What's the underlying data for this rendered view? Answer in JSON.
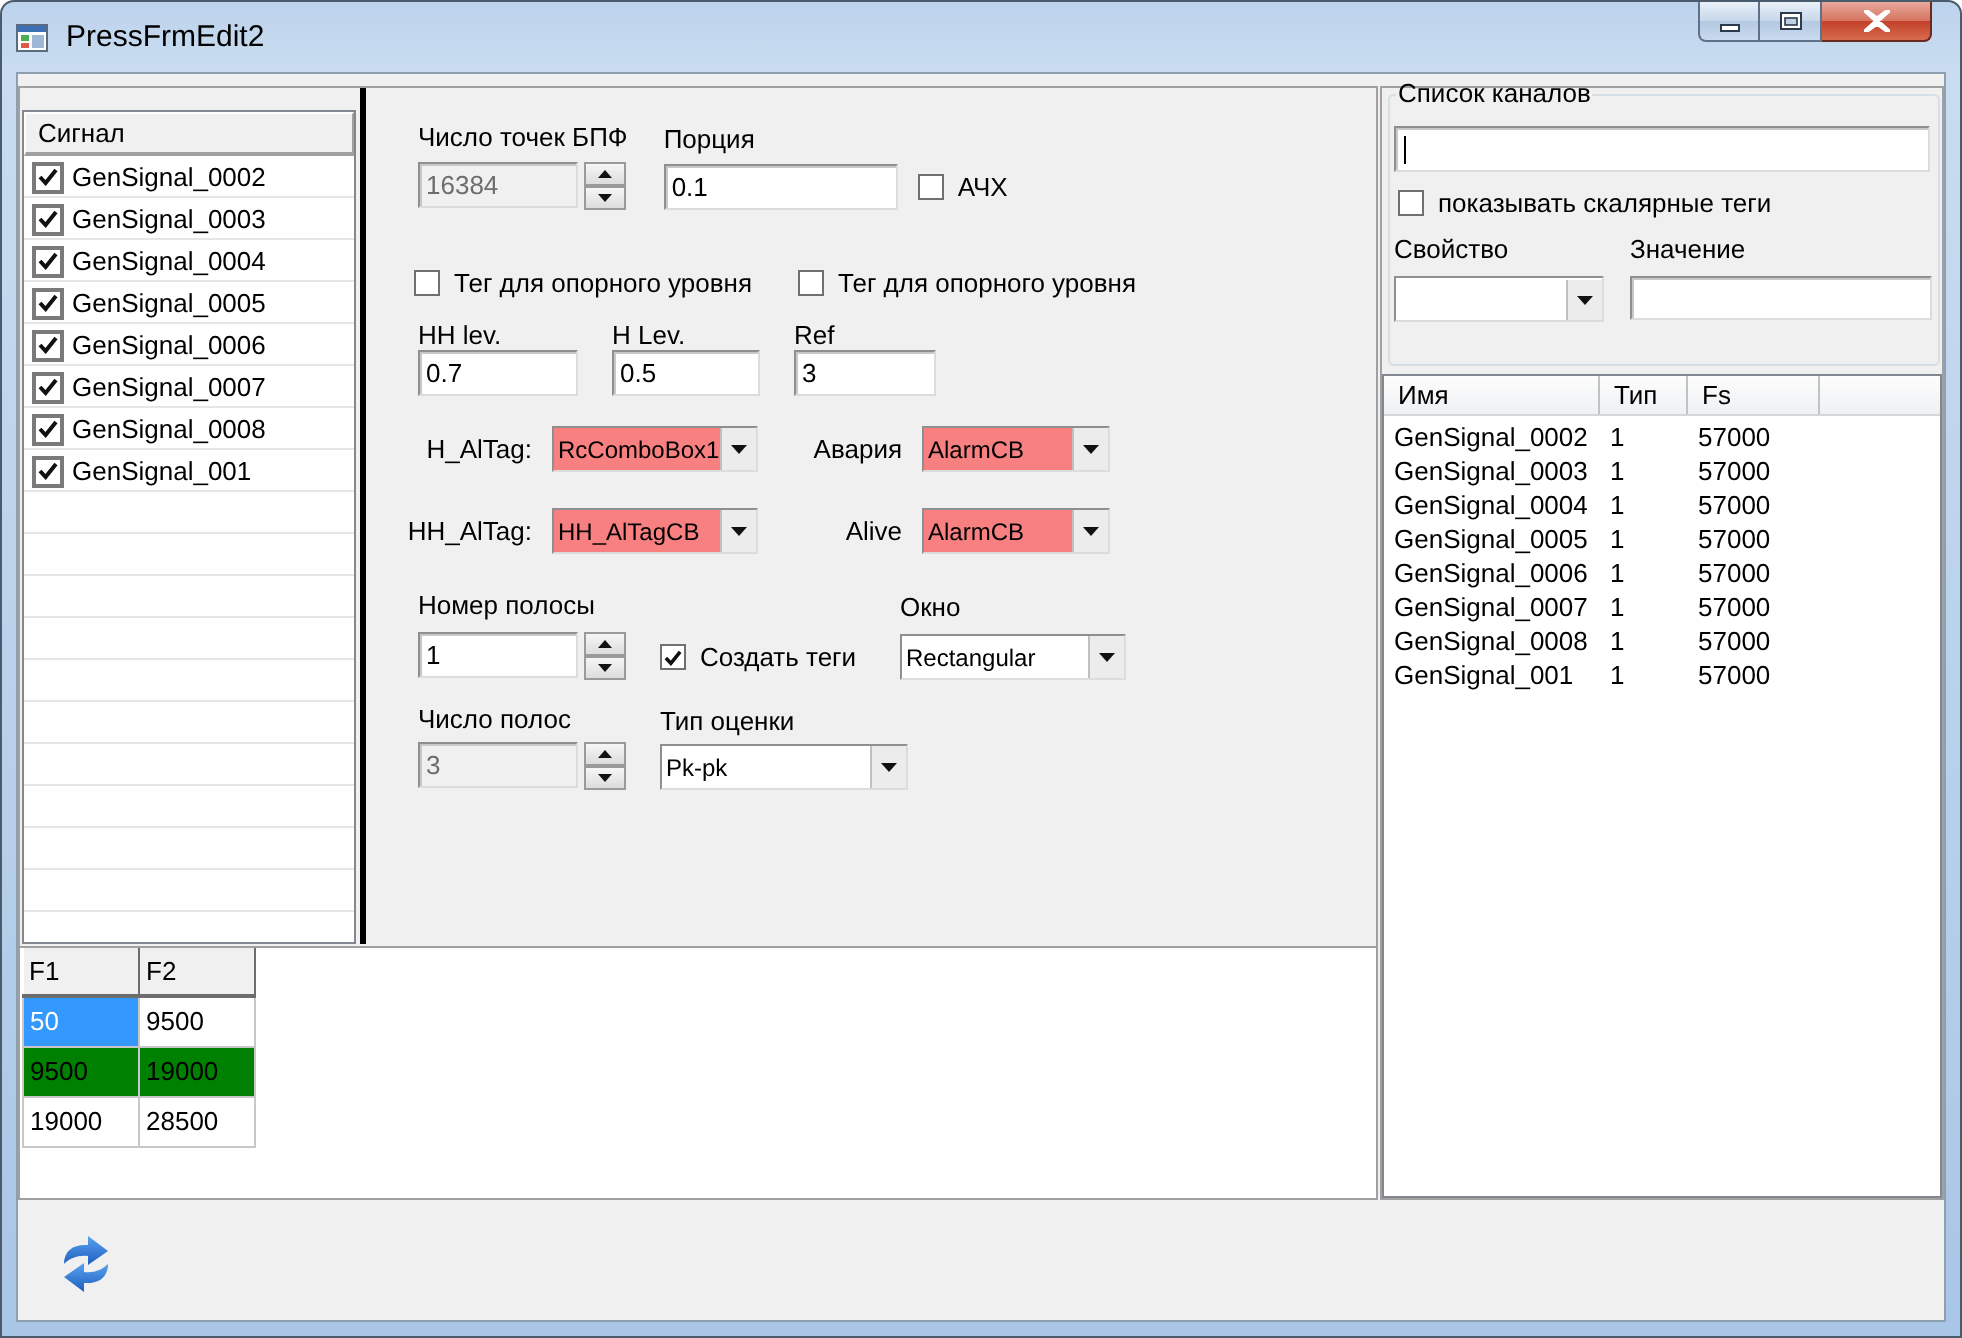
{
  "window": {
    "title": "PressFrmEdit2"
  },
  "signal_list": {
    "header": "Сигнал",
    "items": [
      {
        "label": "GenSignal_0002",
        "checked": true
      },
      {
        "label": "GenSignal_0003",
        "checked": true
      },
      {
        "label": "GenSignal_0004",
        "checked": true
      },
      {
        "label": "GenSignal_0005",
        "checked": true
      },
      {
        "label": "GenSignal_0006",
        "checked": true
      },
      {
        "label": "GenSignal_0007",
        "checked": true
      },
      {
        "label": "GenSignal_0008",
        "checked": true
      },
      {
        "label": "GenSignal_001",
        "checked": true
      }
    ]
  },
  "settings": {
    "fft_points": {
      "label": "Число точек БПФ",
      "value": "16384",
      "disabled": true
    },
    "portion": {
      "label": "Порция",
      "value": "0.1"
    },
    "afc": {
      "label": "АЧХ",
      "checked": false
    },
    "ref_tags": [
      {
        "label": "Тег для опорного уровня",
        "checked": false
      },
      {
        "label": "Тег для опорного уровня",
        "checked": false
      }
    ],
    "levels": [
      {
        "label": "HH lev.",
        "value": "0.7"
      },
      {
        "label": "H Lev.",
        "value": "0.5"
      },
      {
        "label": "Ref",
        "value": "3"
      }
    ],
    "alarm_tags": [
      {
        "label": "H_AlTag:",
        "value": "RcComboBox1",
        "highlighted": true
      },
      {
        "label": "Авария",
        "value": "AlarmCB",
        "highlighted": true
      },
      {
        "label": "HH_AlTag:",
        "value": "HH_AlTagCB",
        "highlighted": true
      },
      {
        "label": "Alive",
        "value": "AlarmCB",
        "highlighted": true
      }
    ],
    "band_number": {
      "label": "Номер полосы",
      "value": "1",
      "disabled": false
    },
    "create_tags": {
      "label": "Создать теги",
      "checked": true
    },
    "window_function": {
      "label": "Окно",
      "value": "Rectangular",
      "highlighted": false
    },
    "band_count": {
      "label": "Число полос",
      "value": "3",
      "disabled": true
    },
    "estimate_type": {
      "label": "Тип оценки",
      "value": "Pk-pk",
      "highlighted": false
    }
  },
  "band_table": {
    "columns": [
      "F1",
      "F2"
    ],
    "rows": [
      {
        "color": "#ffffff",
        "cells": [
          {
            "text": "50",
            "selected": true
          },
          {
            "text": "9500",
            "selected": false
          }
        ]
      },
      {
        "color": "#008000",
        "cells": [
          {
            "text": "9500",
            "selected": false
          },
          {
            "text": "19000",
            "selected": false
          }
        ]
      },
      {
        "color": "#ffffff",
        "cells": [
          {
            "text": "19000",
            "selected": false
          },
          {
            "text": "28500",
            "selected": false
          }
        ]
      }
    ]
  },
  "channels": {
    "title": "Список каналов",
    "show_scalar": {
      "label": "показывать скалярные теги",
      "checked": false
    },
    "property": {
      "label": "Свойство"
    },
    "value": {
      "label": "Значение"
    },
    "table": {
      "columns": [
        "Имя",
        "Тип",
        "Fs"
      ],
      "rows": [
        [
          "GenSignal_0002",
          "1",
          "57000"
        ],
        [
          "GenSignal_0003",
          "1",
          "57000"
        ],
        [
          "GenSignal_0004",
          "1",
          "57000"
        ],
        [
          "GenSignal_0005",
          "1",
          "57000"
        ],
        [
          "GenSignal_0006",
          "1",
          "57000"
        ],
        [
          "GenSignal_0007",
          "1",
          "57000"
        ],
        [
          "GenSignal_0008",
          "1",
          "57000"
        ],
        [
          "GenSignal_001",
          "1",
          "57000"
        ]
      ]
    }
  }
}
